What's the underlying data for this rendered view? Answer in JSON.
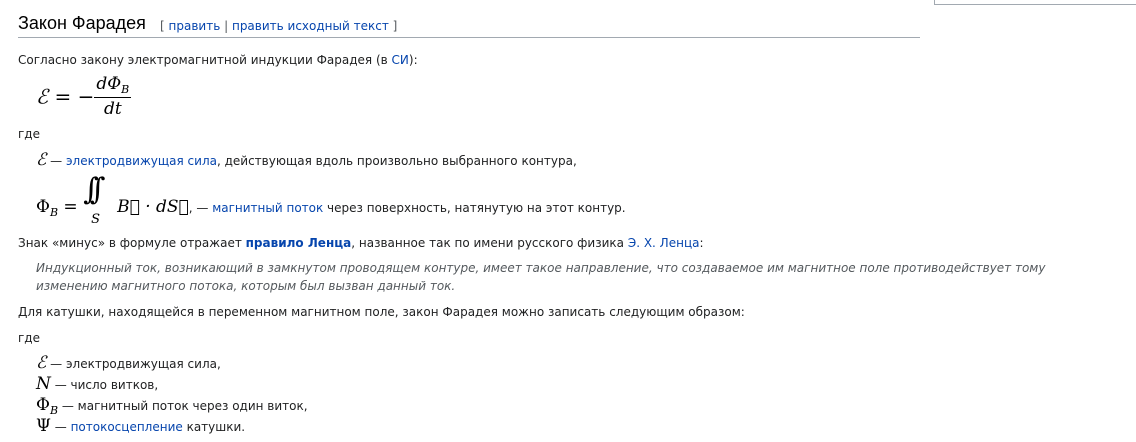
{
  "heading": {
    "title": "Закон Фарадея",
    "edit_open": "[",
    "edit_label": "править",
    "edit_separator": "|",
    "edit_source_label": "править исходный текст",
    "edit_close": "]"
  },
  "intro": {
    "text_before": "Согласно закону электромагнитной индукции Фарадея (в ",
    "link_si": "СИ",
    "text_after": "):"
  },
  "formula1": {
    "emf": "ℰ",
    "equals_minus": " = −",
    "numerator": "dΦ",
    "numerator_sub": "B",
    "denominator": "dt"
  },
  "where1": "где",
  "defs1": [
    {
      "symbol": "ℰ",
      "dash": " — ",
      "link": "электродвижущая сила",
      "text": ", действующая вдоль произвольно выбранного контура,"
    },
    {
      "symbol": "Φ",
      "symbol_sub": "B",
      "equals": " = ",
      "integral": "∫∫",
      "integral_lower": "S",
      "vector_expr": "B⃗ · dS⃗",
      "dash": ", — ",
      "link": "магнитный поток",
      "text": " через поверхность, натянутую на этот контур."
    }
  ],
  "lenz": {
    "text_before": "Знак «минус» в формуле отражает ",
    "link_rule": "правило Ленца",
    "text_middle": ", названное так по имени русского физика ",
    "link_person": "Э. Х. Ленца",
    "text_after": ":"
  },
  "quote": "Индукционный ток, возникающий в замкнутом проводящем контуре, имеет такое направление, что создаваемое им магнитное поле противодействует тому изменению магнитного потока, которым был вызван данный ток.",
  "coil": "Для катушки, находящейся в переменном магнитном поле, закон Фарадея можно записать следующим образом:",
  "where2": "где",
  "defs2": [
    {
      "symbol": "ℰ",
      "dash": " — ",
      "text": "электродвижущая сила,"
    },
    {
      "symbol": "N",
      "dash": " — ",
      "text": "число витков,"
    },
    {
      "symbol": "Φ",
      "symbol_sub": "B",
      "dash": " — ",
      "text": "магнитный поток через один виток,"
    },
    {
      "symbol": "Ψ",
      "dash": " — ",
      "link": "потокосцепление",
      "text": " катушки."
    }
  ]
}
